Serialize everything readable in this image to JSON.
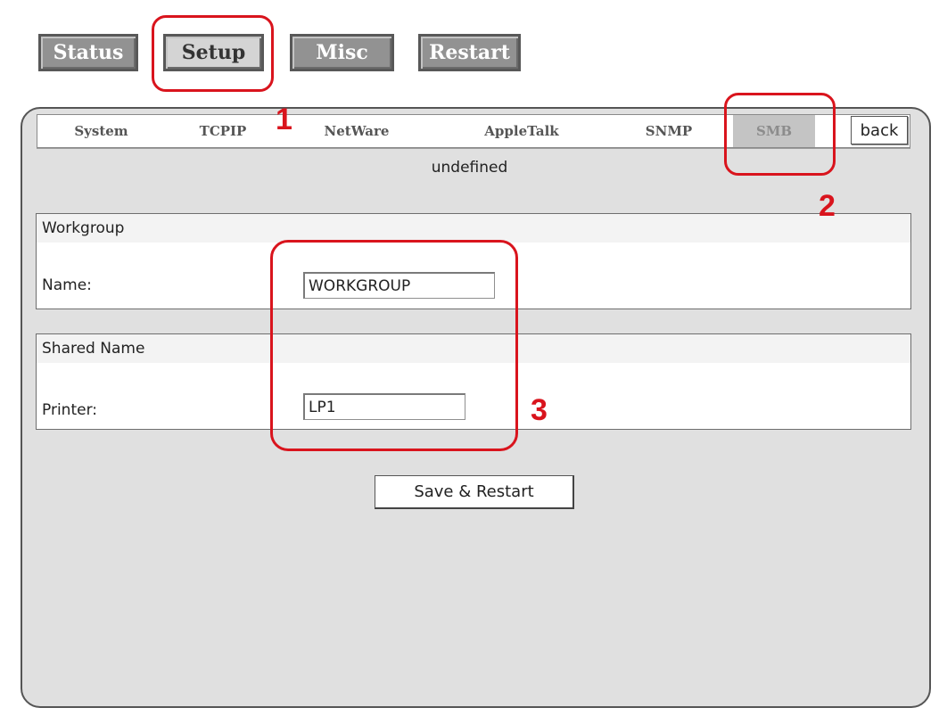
{
  "top_nav": {
    "status": "Status",
    "setup": "Setup",
    "misc": "Misc",
    "restart": "Restart"
  },
  "tabs": {
    "system": "System",
    "tcpip": "TCPIP",
    "netware": "NetWare",
    "appletalk": "AppleTalk",
    "snmp": "SNMP",
    "smb": "SMB",
    "back": "back"
  },
  "subtitle": "undefined",
  "workgroup": {
    "heading": "Workgroup",
    "name_label": "Name:",
    "name_value": "WORKGROUP"
  },
  "shared_name": {
    "heading": "Shared Name",
    "printer_label": "Printer:",
    "printer_value": "LP1"
  },
  "save_button": "Save & Restart",
  "callouts": {
    "one": "1",
    "two": "2",
    "three": "3"
  },
  "colors": {
    "callout": "#d9141d",
    "button_gray": "#929292",
    "panel_bg": "#e0e0e0"
  }
}
